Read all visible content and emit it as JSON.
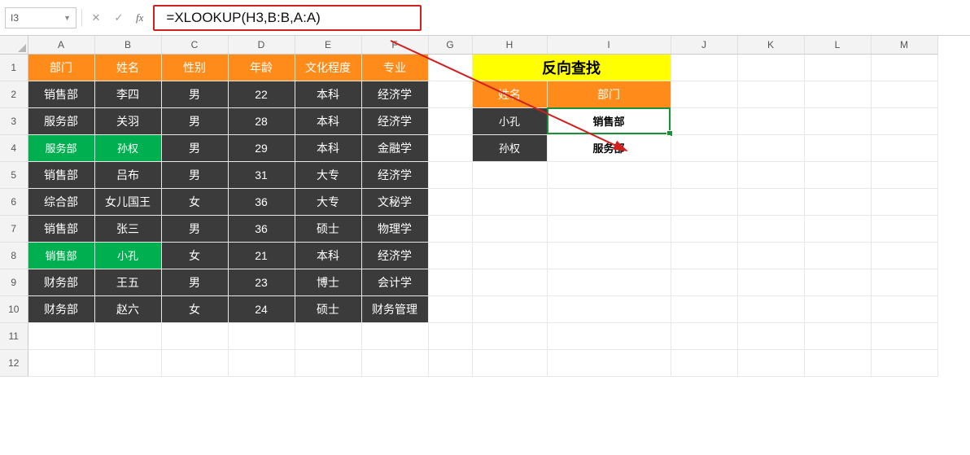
{
  "namebox": "I3",
  "formula": "=XLOOKUP(H3,B:B,A:A)",
  "columns": [
    "A",
    "B",
    "C",
    "D",
    "E",
    "F",
    "G",
    "H",
    "I",
    "J",
    "K",
    "L",
    "M"
  ],
  "rows": [
    "1",
    "2",
    "3",
    "4",
    "5",
    "6",
    "7",
    "8",
    "9",
    "10",
    "11",
    "12"
  ],
  "table_headers": [
    "部门",
    "姓名",
    "性别",
    "年龄",
    "文化程度",
    "专业"
  ],
  "table_data": [
    {
      "dept": "销售部",
      "name": "李四",
      "sex": "男",
      "age": "22",
      "edu": "本科",
      "major": "经济学",
      "hl": false
    },
    {
      "dept": "服务部",
      "name": "关羽",
      "sex": "男",
      "age": "28",
      "edu": "本科",
      "major": "经济学",
      "hl": false
    },
    {
      "dept": "服务部",
      "name": "孙权",
      "sex": "男",
      "age": "29",
      "edu": "本科",
      "major": "金融学",
      "hl": true
    },
    {
      "dept": "销售部",
      "name": "吕布",
      "sex": "男",
      "age": "31",
      "edu": "大专",
      "major": "经济学",
      "hl": false
    },
    {
      "dept": "综合部",
      "name": "女儿国王",
      "sex": "女",
      "age": "36",
      "edu": "大专",
      "major": "文秘学",
      "hl": false
    },
    {
      "dept": "销售部",
      "name": "张三",
      "sex": "男",
      "age": "36",
      "edu": "硕士",
      "major": "物理学",
      "hl": false
    },
    {
      "dept": "销售部",
      "name": "小孔",
      "sex": "女",
      "age": "21",
      "edu": "本科",
      "major": "经济学",
      "hl": true
    },
    {
      "dept": "财务部",
      "name": "王五",
      "sex": "男",
      "age": "23",
      "edu": "博士",
      "major": "会计学",
      "hl": false
    },
    {
      "dept": "财务部",
      "name": "赵六",
      "sex": "女",
      "age": "24",
      "edu": "硕士",
      "major": "财务管理",
      "hl": false
    }
  ],
  "lookup": {
    "title": "反向查找",
    "hdr_name": "姓名",
    "hdr_dept": "部门",
    "rows": [
      {
        "name": "小孔",
        "dept": "销售部"
      },
      {
        "name": "孙权",
        "dept": "服务部"
      }
    ]
  },
  "colors": {
    "formula_box_border": "#d02020",
    "header_bg": "#ff8c1a",
    "dark_bg": "#3b3b3b",
    "highlight_green": "#00b050",
    "title_yellow": "#ffff00",
    "selection": "#1a8f3c"
  }
}
